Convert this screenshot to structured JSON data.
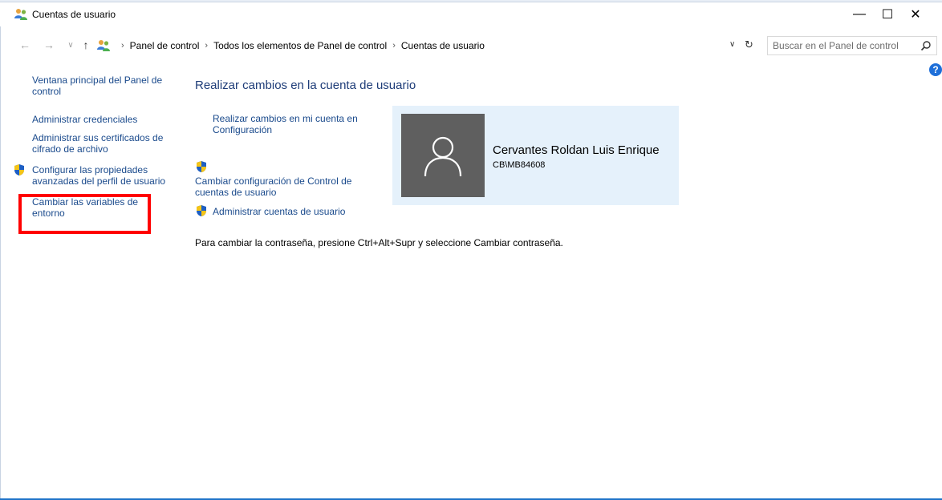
{
  "window": {
    "title": "Cuentas de usuario",
    "minimize_symbol": "—",
    "maximize_symbol": "☐",
    "close_symbol": "✕"
  },
  "address_bar": {
    "back_symbol": "←",
    "forward_symbol": "→",
    "recent_symbol": "∨",
    "up_symbol": "↑",
    "breadcrumbs": [
      "Panel de control",
      "Todos los elementos de Panel de control",
      "Cuentas de usuario"
    ],
    "separator": "›",
    "dropdown_symbol": "∨",
    "refresh_symbol": "↻",
    "search_placeholder": "Buscar en el Panel de control"
  },
  "help": {
    "symbol": "?"
  },
  "sidebar": {
    "items": [
      {
        "label": "Ventana principal del Panel de control"
      },
      {
        "label": "Administrar credenciales"
      },
      {
        "label": "Administrar sus certificados de cifrado de archivo"
      },
      {
        "label": "Configurar las propiedades avanzadas del perfil de usuario"
      },
      {
        "label": "Cambiar las variables de entorno"
      }
    ]
  },
  "main": {
    "title": "Realizar cambios en la cuenta de usuario",
    "links": [
      {
        "label": "Realizar cambios en mi cuenta en Configuración"
      },
      {
        "label": "Cambiar configuración de Control de cuentas de usuario"
      },
      {
        "label": "Administrar cuentas de usuario"
      }
    ],
    "user": {
      "name": "Cervantes Roldan Luis Enrique",
      "account": "CB\\MB84608"
    },
    "password_note": "Para cambiar la contraseña, presione Ctrl+Alt+Supr y seleccione Cambiar contraseña."
  },
  "icons": {
    "app": "users-icon",
    "shield": "uac-shield-icon",
    "avatar": "user-silhouette-icon",
    "search": "search-icon"
  },
  "colors": {
    "link": "#1a4a8c",
    "title": "#1e3c78",
    "card_bg": "#e5f1fb",
    "avatar_bg": "#5f5f5f",
    "highlight": "#ff0000"
  }
}
